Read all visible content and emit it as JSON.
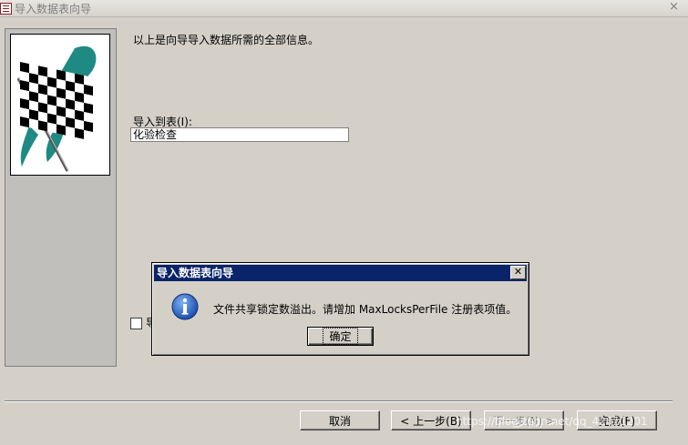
{
  "window": {
    "title": "导入数据表向导",
    "close_glyph": "×"
  },
  "wizard": {
    "info_text": "以上是向导导入数据所需的全部信息。",
    "import_to_table_label": "导入到表(I):",
    "table_name_value": "化验检查",
    "analyze_checkbox_checked": false,
    "analyze_label_visible": "导"
  },
  "buttons": {
    "cancel": "取消",
    "back": "< 上一步(B)",
    "next": "下一步(N) >",
    "finish": "完成(F)"
  },
  "dialog": {
    "title": "导入数据表向导",
    "message": "文件共享锁定数溢出。请增加 MaxLocksPerFile 注册表项值。",
    "ok": "确定",
    "close_glyph": "✕"
  },
  "watermark": "https://blog.csdn.net/qq_42011201",
  "colors": {
    "dialog_title_bg": "#0a246a",
    "window_bg": "#d4d0c8",
    "side_panel_bg": "#c0bfbc",
    "flag_teal": "#1f8a84"
  }
}
